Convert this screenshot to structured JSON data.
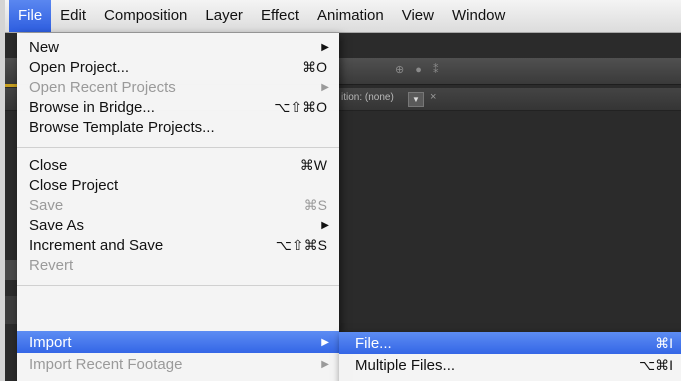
{
  "menubar": {
    "items": [
      "File",
      "Edit",
      "Composition",
      "Layer",
      "Effect",
      "Animation",
      "View",
      "Window"
    ]
  },
  "app": {
    "comp_tab_label": "ition: (none)",
    "comp_tab_dropdown": "▼",
    "comp_tab_close": "×"
  },
  "file_menu": {
    "items": [
      {
        "label": "New",
        "shortcut": "",
        "submenu": true,
        "enabled": true
      },
      {
        "label": "Open Project...",
        "shortcut": "⌘O",
        "submenu": false,
        "enabled": true
      },
      {
        "label": "Open Recent Projects",
        "shortcut": "",
        "submenu": true,
        "enabled": false
      },
      {
        "label": "Browse in Bridge...",
        "shortcut": "⌥⇧⌘O",
        "submenu": false,
        "enabled": true
      },
      {
        "label": "Browse Template Projects...",
        "shortcut": "",
        "submenu": false,
        "enabled": true
      },
      {
        "label": "Close",
        "shortcut": "⌘W",
        "submenu": false,
        "enabled": true
      },
      {
        "label": "Close Project",
        "shortcut": "",
        "submenu": false,
        "enabled": true
      },
      {
        "label": "Save",
        "shortcut": "⌘S",
        "submenu": false,
        "enabled": false
      },
      {
        "label": "Save As",
        "shortcut": "",
        "submenu": true,
        "enabled": true
      },
      {
        "label": "Increment and Save",
        "shortcut": "⌥⇧⌘S",
        "submenu": false,
        "enabled": true
      },
      {
        "label": "Revert",
        "shortcut": "",
        "submenu": false,
        "enabled": false
      },
      {
        "label": "Import",
        "shortcut": "",
        "submenu": true,
        "enabled": true,
        "highlighted": true
      },
      {
        "label": "Import Recent Footage",
        "shortcut": "",
        "submenu": true,
        "enabled": false
      }
    ],
    "arrow_glyph": "▶"
  },
  "import_submenu": {
    "items": [
      {
        "label": "File...",
        "shortcut": "⌘I",
        "highlighted": true
      },
      {
        "label": "Multiple Files...",
        "shortcut": "⌥⌘I",
        "highlighted": false
      }
    ]
  },
  "colors": {
    "highlight": "#3466e6",
    "menu_bg": "#f8f8f8",
    "app_bg": "#2b2b2b",
    "disabled_text": "#9a9a9a"
  }
}
